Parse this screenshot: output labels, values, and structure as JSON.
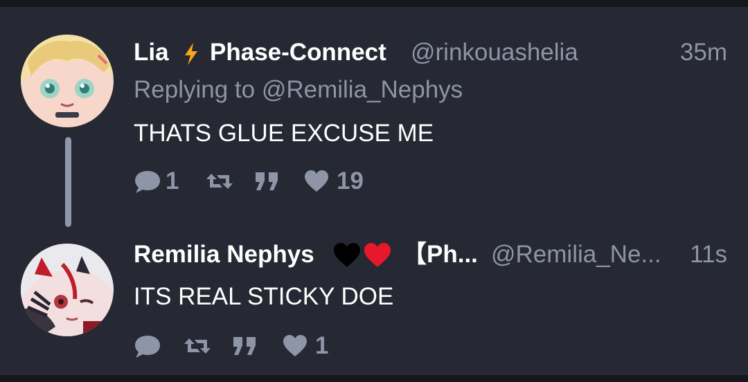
{
  "colors": {
    "background": "#262833",
    "name": "#ffffff",
    "meta": "#8d95a6",
    "thread_line": "#8e98ac",
    "lightning": "#f7a71b",
    "heart": "#e8182c"
  },
  "tweets": [
    {
      "display_name": "Lia",
      "name_icon": "lightning-icon",
      "name_suffix": "Phase-Connect",
      "handle": "@rinkouashelia",
      "time": "35m",
      "replying_to": "Replying to @Remilia_Nephys",
      "text": "THATS GLUE EXCUSE ME",
      "actions": {
        "reply_icon": "comment-icon",
        "reply_count": "1",
        "retweet_icon": "retweet-icon",
        "quote_icon": "quote-icon",
        "like_icon": "heart-icon",
        "like_count": "19"
      }
    },
    {
      "display_name": "Remilia Nephys",
      "name_emojis": [
        "black-heart-icon",
        "red-heart-icon"
      ],
      "name_suffix": "【Ph...",
      "handle": "@Remilia_Ne...",
      "time": "11s",
      "text": "ITS REAL STICKY DOE",
      "actions": {
        "reply_icon": "comment-icon",
        "reply_count": "",
        "retweet_icon": "retweet-icon",
        "quote_icon": "quote-icon",
        "like_icon": "heart-icon",
        "like_count": "1"
      }
    }
  ]
}
